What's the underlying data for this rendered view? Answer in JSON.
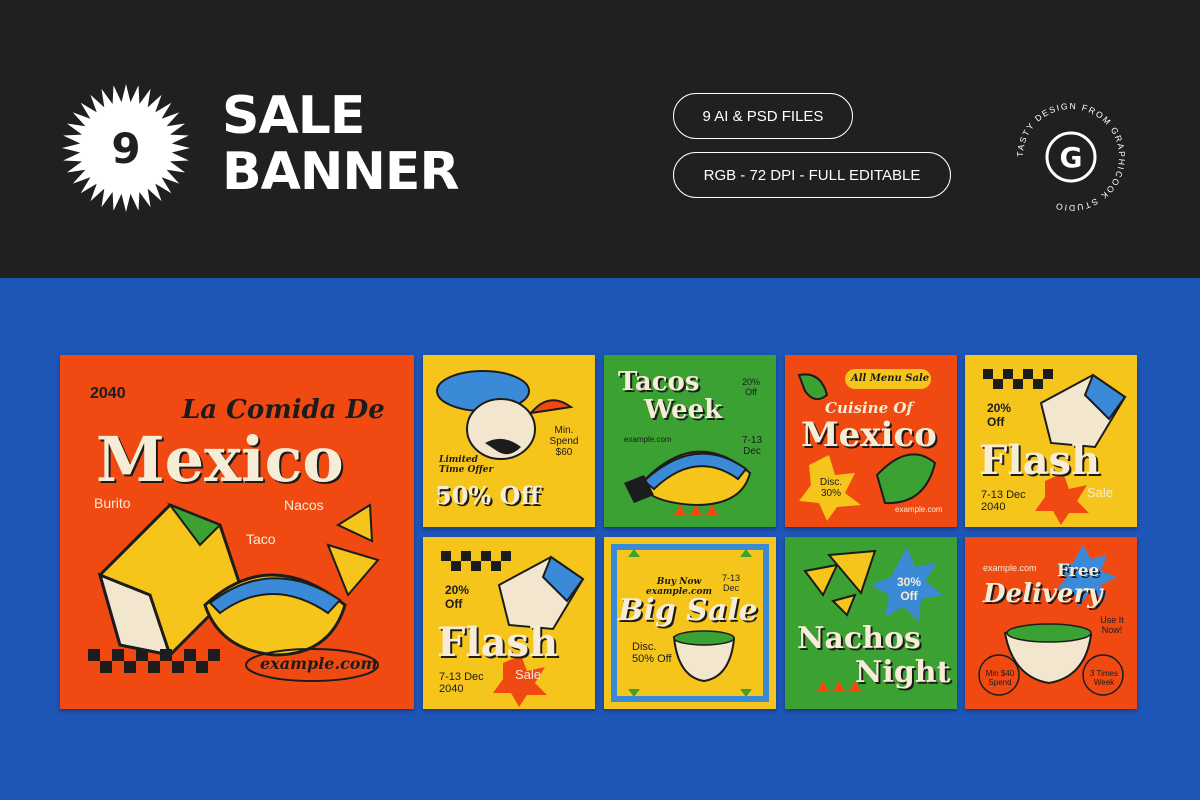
{
  "header": {
    "count_badge": "9",
    "title_line1": "SALE",
    "title_line2": "BANNER",
    "file_info": "9 AI & PSD FILES",
    "spec_info": "RGB - 72 DPI - FULL EDITABLE",
    "studio_ring_text": "TASTY DESIGN FROM GRAPHICOOK STUDIO",
    "studio_logo_letter": "G"
  },
  "colors": {
    "header_bg": "#202020",
    "canvas_bg": "#1e56b8",
    "orange": "#f04a12",
    "yellow": "#f6c51b",
    "green": "#3aa132",
    "cream": "#f7ecd5",
    "blue_accent": "#3b8ad8"
  },
  "cards": {
    "big": {
      "year": "2040",
      "subtitle": "La Comida De",
      "title": "Mexico",
      "label_burito": "Burito",
      "label_nacos": "Nacos",
      "label_taco": "Taco",
      "website": "example.com"
    },
    "c1": {
      "min_spend": "Min. Spend $60",
      "limited": "Limited Time Offer",
      "discount": "50% Off"
    },
    "c2": {
      "title1": "Tacos",
      "title2": "Week",
      "badge": "20% Off",
      "date": "7-13 Dec",
      "website": "example.com"
    },
    "c3": {
      "tag": "All Menu Sale",
      "subtitle": "Cuisine Of",
      "title": "Mexico",
      "disc": "Disc. 30%",
      "website": "example.com"
    },
    "c4": {
      "pct": "20% Off",
      "title": "Flash",
      "sale": "Sale",
      "date": "7-13 Dec 2040"
    },
    "c5": {
      "pct": "20% Off",
      "title": "Flash",
      "sale": "Sale",
      "date": "7-13 Dec 2040"
    },
    "c6": {
      "buy_now": "Buy Now example.com",
      "date": "7-13 Dec",
      "title": "Big Sale",
      "disc": "Disc. 50% Off"
    },
    "c7": {
      "badge": "30% Off",
      "title1": "Nachos",
      "title2": "Night"
    },
    "c8": {
      "website": "example.com",
      "title1": "Free",
      "title2": "Delivery",
      "use_it": "Use It Now!",
      "min_spend": "Min $40 Spend",
      "times": "3 Times Week"
    }
  }
}
